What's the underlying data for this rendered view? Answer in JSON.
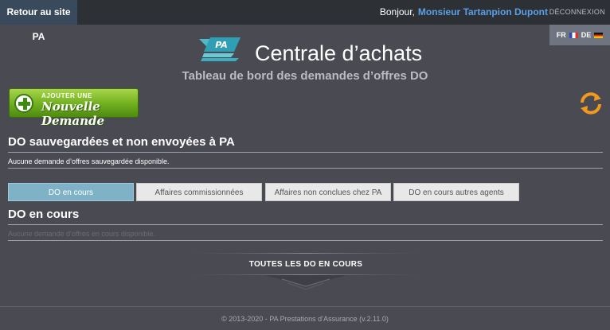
{
  "topbar": {
    "back_label": "Retour au site PA",
    "greeting": "Bonjour,",
    "user_name": "Monsieur Tartanpion Dupont",
    "logout_label": "DÉCONNEXION"
  },
  "languages": [
    {
      "code": "FR"
    },
    {
      "code": "DE"
    }
  ],
  "header": {
    "title": "Centrale d’achats",
    "subtitle": "Tableau de bord des demandes d’offres DO"
  },
  "new_request": {
    "small_label": "AJOUTER UNE",
    "big_label": "Nouvelle Demande"
  },
  "saved_section": {
    "title": "DO sauvegardées et non envoyées à PA",
    "empty_text": "Aucune demande d’offres sauvegardée disponible."
  },
  "tabs": [
    {
      "label": "DO en cours",
      "active": true
    },
    {
      "label": "Affaires commissionnées",
      "active": false
    },
    {
      "label": "Affaires non conclues chez PA",
      "active": false
    },
    {
      "label": "DO en cours autres agents",
      "active": false
    }
  ],
  "current_section": {
    "title": "DO en cours",
    "empty_text": "Aucune demande d’offres en cours disponible."
  },
  "all_button": {
    "label": "TOUTES LES DO EN COURS"
  },
  "footer": {
    "text": "© 2013-2020 - PA Prestations d’Assurance (v.2.11.0)"
  },
  "colors": {
    "background": "#4a4a52",
    "topbar": "#2d3035",
    "back_link": "#394a5c",
    "user_link": "#5aa0e6",
    "active_tab": "#7fb2c6",
    "accent_green": "#6fae1e",
    "refresh_orange": "#f29a1e"
  },
  "icons": {
    "logo": "pa-logo",
    "add": "plus-circle-icon",
    "refresh": "refresh-icon"
  }
}
